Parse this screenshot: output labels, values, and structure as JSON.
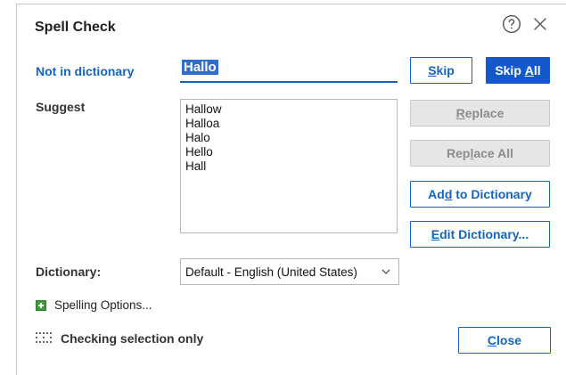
{
  "dialog": {
    "title": "Spell Check",
    "help_icon": "help-circle-icon",
    "close_icon": "close-icon"
  },
  "not_in_dictionary": {
    "label": "Not in dictionary",
    "value": "Hallo"
  },
  "suggest": {
    "label": "Suggest",
    "items": [
      "Hallow",
      "Halloa",
      "Halo",
      "Hello",
      "Hall"
    ]
  },
  "buttons": {
    "skip": {
      "prefix": "",
      "mnemonic": "S",
      "suffix": "kip"
    },
    "skip_all": {
      "prefix": "Skip ",
      "mnemonic": "A",
      "suffix": "ll"
    },
    "replace": {
      "prefix": "",
      "mnemonic": "R",
      "suffix": "eplace"
    },
    "replace_all": {
      "prefix": "Rep",
      "mnemonic": "l",
      "suffix": "ace All"
    },
    "add_to_dictionary": {
      "prefix": "Ad",
      "mnemonic": "d",
      "suffix": " to Dictionary"
    },
    "edit_dictionary": {
      "prefix": "",
      "mnemonic": "E",
      "suffix": "dit Dictionary..."
    },
    "close": {
      "prefix": "",
      "mnemonic": "C",
      "suffix": "lose"
    }
  },
  "dictionary": {
    "label": "Dictionary:",
    "selected": "Default - English (United States)"
  },
  "spelling_options": {
    "label": "Spelling Options..."
  },
  "status": {
    "text": "Checking selection only"
  },
  "colors": {
    "accent": "#1565c0",
    "primary_button": "#1458c9",
    "disabled_button": "#e6e6e6",
    "options_icon": "#3c9b3c"
  }
}
